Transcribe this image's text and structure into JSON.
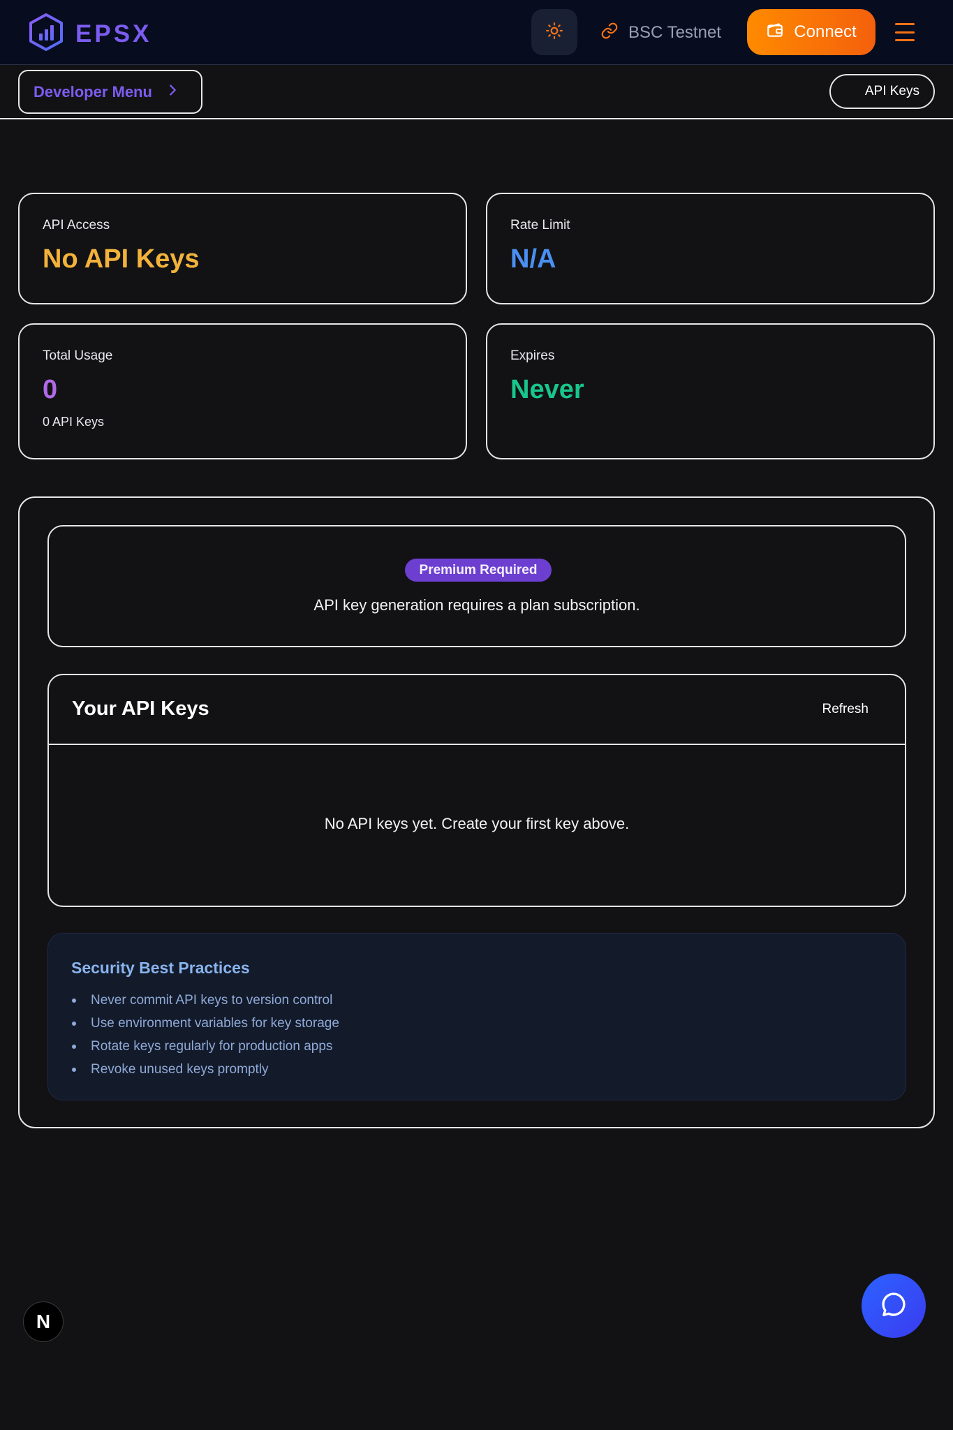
{
  "header": {
    "logo_text": "EPSX",
    "network_label": "BSC Testnet",
    "connect_label": "Connect"
  },
  "subbar": {
    "developer_menu_label": "Developer Menu",
    "current_page_label": "API Keys"
  },
  "stats": {
    "api_access": {
      "label": "API Access",
      "value": "No API Keys"
    },
    "rate_limit": {
      "label": "Rate Limit",
      "value": "N/A"
    },
    "total_usage": {
      "label": "Total Usage",
      "value": "0",
      "sub": "0 API Keys"
    },
    "expires": {
      "label": "Expires",
      "value": "Never"
    }
  },
  "premium": {
    "badge": "Premium Required",
    "message": "API key generation requires a plan subscription."
  },
  "keys": {
    "title": "Your API Keys",
    "refresh_label": "Refresh",
    "empty_message": "No API keys yet. Create your first key above."
  },
  "security": {
    "title": "Security Best Practices",
    "items": [
      "Never commit API keys to version control",
      "Use environment variables for key storage",
      "Rotate keys regularly for production apps",
      "Revoke unused keys promptly"
    ]
  },
  "floating": {
    "dev_badge": "N"
  },
  "colors": {
    "brand_purple": "#7c5cf0",
    "connect_orange": "#ff8a00",
    "amber": "#f3b23a",
    "blue": "#4a8ff2",
    "purple": "#b06ae8",
    "green": "#18c58a",
    "chat_blue": "#2c62ff"
  },
  "icons": {
    "logo": "hexagon-chart-logo-icon",
    "theme": "sun-icon",
    "network": "link-icon",
    "connect": "wallet-icon",
    "menu": "hamburger-menu-icon",
    "developer_menu": "chevron-right-icon",
    "chat": "chat-bubble-icon"
  }
}
